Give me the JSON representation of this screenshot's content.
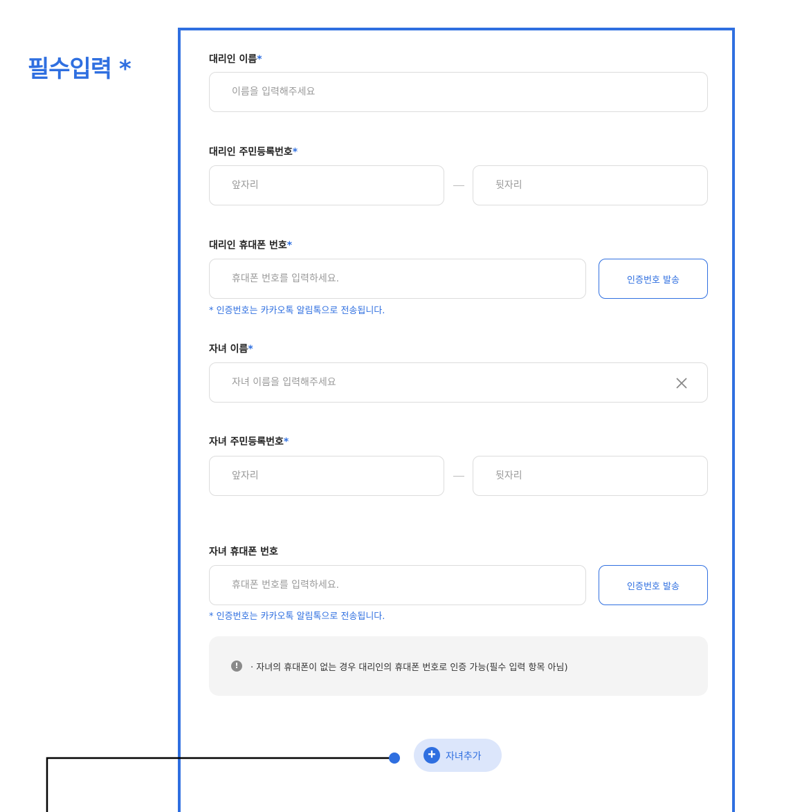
{
  "section_title": "필수입력 *",
  "required_mark": "*",
  "agent_name": {
    "label": "대리인 이름",
    "placeholder": "이름을 입력해주세요"
  },
  "agent_rrn": {
    "label": "대리인 주민등록번호",
    "front_placeholder": "앞자리",
    "back_placeholder": "뒷자리"
  },
  "agent_phone": {
    "label": "대리인 휴대폰 번호",
    "placeholder": "휴대폰 번호를 입력하세요.",
    "send_button": "인증번호 발송",
    "note": "* 인증번호는 카카오톡 알림톡으로 전송됩니다."
  },
  "child_name": {
    "label": "자녀 이름",
    "placeholder": "자녀 이름을 입력해주세요",
    "clear_icon": "close-icon"
  },
  "child_rrn": {
    "label": "자녀 주민등록번호",
    "front_placeholder": "앞자리",
    "back_placeholder": "뒷자리"
  },
  "child_phone": {
    "label": "자녀 휴대폰 번호",
    "placeholder": "휴대폰 번호를 입력하세요.",
    "send_button": "인증번호 발송",
    "note": "* 인증번호는 카카오톡 알림톡으로 전송됩니다."
  },
  "info": {
    "icon": "info-icon",
    "glyph": "!",
    "text": "· 자녀의 휴대폰이 없는 경우 대리인의 휴대폰 번호로 인증 가능(필수 입력 항목 아님)"
  },
  "add_child": {
    "icon": "plus-circle-icon",
    "glyph": "+",
    "label": "자녀추가"
  },
  "colors": {
    "accent": "#2f6fe0",
    "add_button_bg": "#dce6fb",
    "info_bg": "#f4f4f4",
    "field_border": "#dcdcdc"
  }
}
